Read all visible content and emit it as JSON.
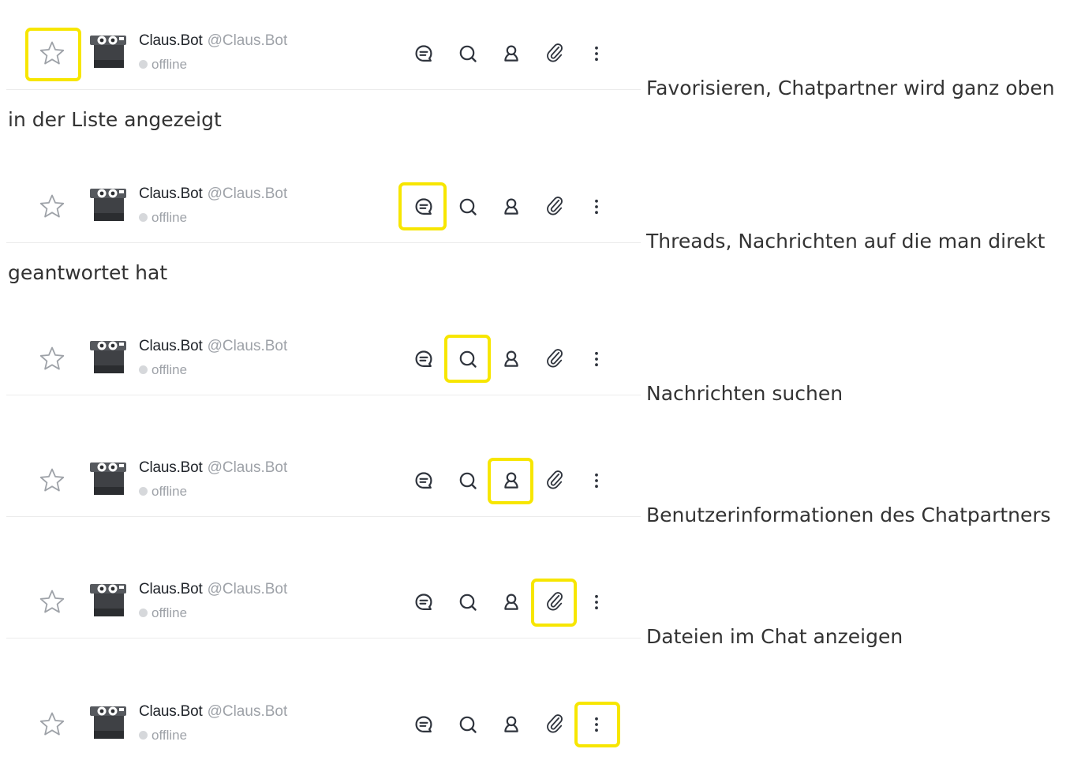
{
  "chat_header": {
    "display_name": "Claus.Bot",
    "username": "@Claus.Bot",
    "status": "offline"
  },
  "icons": {
    "favorite": "star-icon",
    "avatar": "bot-avatar",
    "threads": "threads-icon",
    "search": "search-icon",
    "user_info": "user-icon",
    "files": "paperclip-icon",
    "menu": "kebab-menu-icon"
  },
  "highlight_color": "#f7e600",
  "captions": {
    "favorite_line1": "Favorisieren, Chatpartner wird ganz oben",
    "favorite_line2": "in der Liste angezeigt",
    "threads_line1": "Threads, Nachrichten auf die man direkt",
    "threads_line2": "geantwortet hat",
    "search": "Nachrichten suchen",
    "user_info": "Benutzerinformationen des Chatpartners",
    "files": "Dateien im Chat anzeigen"
  }
}
